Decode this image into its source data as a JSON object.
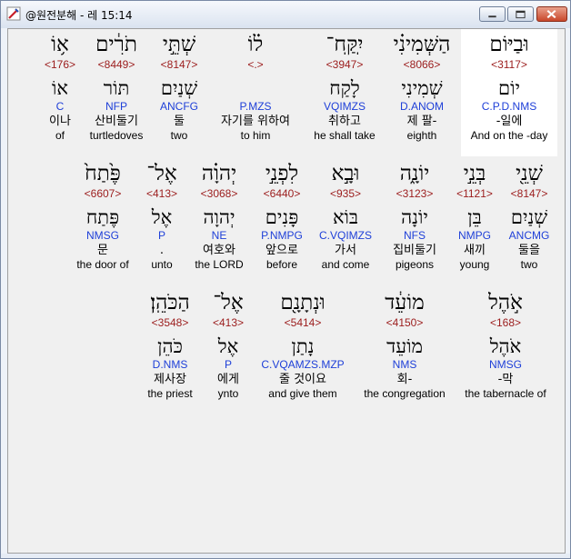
{
  "window": {
    "title": "@원전분해 - 레 15:14"
  },
  "colors": {
    "strong": "#9b1c1c",
    "morph": "#1e3fd8",
    "highlight": "#ffffff"
  },
  "rows": [
    {
      "words": [
        {
          "heb": "וּבַיּוֹם",
          "strong": "<3117>",
          "lex": "יוֹם",
          "morph": "C.P.D.NMS",
          "kor": "-일에",
          "eng": "And on the -day",
          "hl": true
        },
        {
          "heb": "הַשְּׁמִינִ֗י",
          "strong": "<8066>",
          "lex": "שְׁמִינִי",
          "morph": "D.ANOM",
          "kor": "제 팔-",
          "eng": "eighth"
        },
        {
          "heb": "יִֽקַּֽח־",
          "strong": "<3947>",
          "lex": "לָקַח",
          "morph": "VQIMZS",
          "kor": "취하고",
          "eng": "he shall take"
        },
        {
          "heb": "ל֗וֹ",
          "strong": "<.>",
          "lex": "",
          "morph": "P.MZS",
          "kor": "자기를 위하여",
          "eng": "to him"
        },
        {
          "heb": "שְׁתֵּ֣י",
          "strong": "<8147>",
          "lex": "שְׁנַיִם",
          "morph": "ANCFG",
          "kor": "둘",
          "eng": "two"
        },
        {
          "heb": "תֹרִ֔ים",
          "strong": "<8449>",
          "lex": "תּוֹר",
          "morph": "NFP",
          "kor": "산비둘기",
          "eng": "turtledoves"
        },
        {
          "heb": "א֥וֹ",
          "strong": "<176>",
          "lex": "אוֹ",
          "morph": "C",
          "kor": "이나",
          "eng": "of"
        }
      ]
    },
    {
      "words": [
        {
          "heb": "שְׁנֵ֖י",
          "strong": "<8147>",
          "lex": "שְׁנַיִם",
          "morph": "ANCMG",
          "kor": "둘을",
          "eng": "two"
        },
        {
          "heb": "בְּנֵ֣י",
          "strong": "<1121>",
          "lex": "בֵּן",
          "morph": "NMPG",
          "kor": "새끼",
          "eng": "young"
        },
        {
          "heb": "יוֹנָ֑ה",
          "strong": "<3123>",
          "lex": "יוֹנָה",
          "morph": "NFS",
          "kor": "집비둘기",
          "eng": "pigeons"
        },
        {
          "heb": "וּבָ֣א",
          "strong": "<935>",
          "lex": "בּוֹא",
          "morph": "C.VQIMZS",
          "kor": "가서",
          "eng": "and come"
        },
        {
          "heb": "לִפְנֵ֣י",
          "strong": "<6440>",
          "lex": "פָּנִים",
          "morph": "P.NMPG",
          "kor": "앞으로",
          "eng": "before"
        },
        {
          "heb": "יְהוָ֗ה",
          "strong": "<3068>",
          "lex": "יְהוָה",
          "morph": "NE",
          "kor": "여호와",
          "eng": "the LORD"
        },
        {
          "heb": "אֶל־",
          "strong": "<413>",
          "lex": "אֶל",
          "morph": "P",
          "kor": ".",
          "eng": "unto"
        },
        {
          "heb": "פֶּ֙תַח֙",
          "strong": "<6607>",
          "lex": "פֶּתַח",
          "morph": "NMSG",
          "kor": "문",
          "eng": "the door of"
        }
      ]
    },
    {
      "words": [
        {
          "heb": "אֹ֣הֶל",
          "strong": "<168>",
          "lex": "אֹהֶל",
          "morph": "NMSG",
          "kor": "-막",
          "eng": "the tabernacle of"
        },
        {
          "heb": "מוֹעֵ֔ד",
          "strong": "<4150>",
          "lex": "מוֹעֵד",
          "morph": "NMS",
          "kor": "회-",
          "eng": "the congregation"
        },
        {
          "heb": "וּנְתָנָ֖ם",
          "strong": "<5414>",
          "lex": "נָתַן",
          "morph": "C.VQAMZS.MZP",
          "kor": "줄 것이요",
          "eng": "and give them"
        },
        {
          "heb": "אֶל־",
          "strong": "<413>",
          "lex": "אֶל",
          "morph": "P",
          "kor": "에게",
          "eng": "ynto"
        },
        {
          "heb": "הַכֹּהֵֽן׃",
          "strong": "<3548>",
          "lex": "כֹּהֵן",
          "morph": "D.NMS",
          "kor": "제사장",
          "eng": "the priest"
        }
      ]
    }
  ]
}
